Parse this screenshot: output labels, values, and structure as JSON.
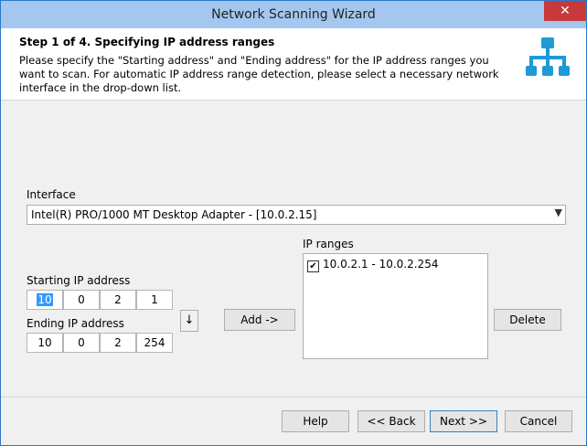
{
  "window": {
    "title": "Network Scanning Wizard",
    "close_glyph": "✕"
  },
  "header": {
    "step": "Step 1 of 4. Specifying IP address ranges",
    "description": "Please specify the \"Starting address\" and \"Ending address\" for the IP address ranges you want to scan. For automatic IP address range detection, please select a necessary network interface in the drop-down list.",
    "icon": "network-icon"
  },
  "interface": {
    "label": "Interface",
    "value": "Intel(R) PRO/1000 MT Desktop Adapter - [10.0.2.15]"
  },
  "start": {
    "label": "Starting IP address",
    "octets": [
      "10",
      "0",
      "2",
      "1"
    ]
  },
  "end": {
    "label": "Ending IP address",
    "octets": [
      "10",
      "0",
      "2",
      "254"
    ]
  },
  "copy_down_glyph": "↓",
  "add_label": "Add ->",
  "ranges": {
    "label": "IP ranges",
    "items": [
      {
        "text": "10.0.2.1 - 10.0.2.254",
        "checked": true,
        "check_glyph": "✔"
      }
    ]
  },
  "delete_label": "Delete",
  "footer": {
    "help": "Help",
    "back": "<< Back",
    "next": "Next >>",
    "cancel": "Cancel"
  },
  "colors": {
    "accent": "#2b79c7",
    "titlebar": "#a3c7ef",
    "close": "#c7393a",
    "selection": "#3399ff"
  }
}
